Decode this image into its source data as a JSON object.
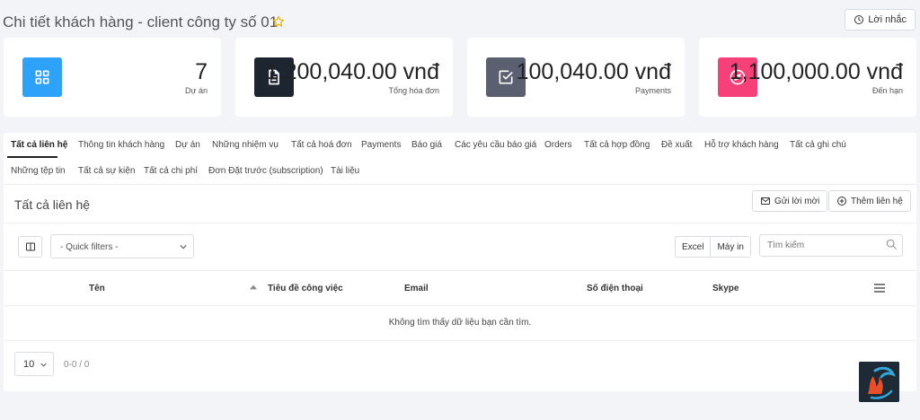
{
  "header": {
    "title": "Chi tiết khách hàng - client công ty số 01",
    "reminder_label": "Lời nhắc"
  },
  "stats": [
    {
      "value": "7",
      "label": "Dự án",
      "icon": "grid-icon",
      "color": "#2ea2f8"
    },
    {
      "value": "1,200,040.00 vnđ",
      "label": "Tổng hóa đơn",
      "icon": "file-icon",
      "color": "#1d2530"
    },
    {
      "value": "100,040.00 vnđ",
      "label": "Payments",
      "icon": "check-square-icon",
      "color": "#5b6071"
    },
    {
      "value": "1,100,000.00 vnđ",
      "label": "Đến hạn",
      "icon": "compass-icon",
      "color": "#f5407a"
    }
  ],
  "tabs": [
    {
      "label": "Tất cả liên hệ",
      "active": true
    },
    {
      "label": "Thông tin khách hàng"
    },
    {
      "label": "Dự án"
    },
    {
      "label": "Những nhiệm vụ"
    },
    {
      "label": "Tất cả hoá đơn"
    },
    {
      "label": "Payments"
    },
    {
      "label": "Báo giá"
    },
    {
      "label": "Các yêu cầu báo giá"
    },
    {
      "label": "Orders"
    },
    {
      "label": "Tất cả hợp đồng"
    },
    {
      "label": "Đề xuất"
    },
    {
      "label": "Hỗ trợ khách hàng"
    },
    {
      "label": "Tất cả ghi chú"
    },
    {
      "label": "Những tệp tin"
    },
    {
      "label": "Tất cả sự kiện"
    },
    {
      "label": "Tất cả chi phí"
    },
    {
      "label": "Đơn Đặt trước (subscription)"
    },
    {
      "label": "Tài liệu"
    }
  ],
  "section": {
    "title": "Tất cả liên hệ",
    "send_invite_label": "Gửi lời mời",
    "add_contact_label": "Thêm liên hệ"
  },
  "toolbar": {
    "quick_filter": "- Quick filters -",
    "excel_label": "Excel",
    "print_label": "Máy in",
    "search_placeholder": "Tìm kiếm"
  },
  "table": {
    "columns": [
      "Tên",
      "Tiêu đề công việc",
      "Email",
      "Số điện thoại",
      "Skype"
    ],
    "empty_message": "Không tìm thấy dữ liệu bạn cần tìm."
  },
  "pagination": {
    "page_size": "10",
    "info": "0-0 / 0"
  },
  "colors": {
    "accent": "#2ea2f8",
    "star": "#f0ad00",
    "danger": "#f5407a"
  }
}
